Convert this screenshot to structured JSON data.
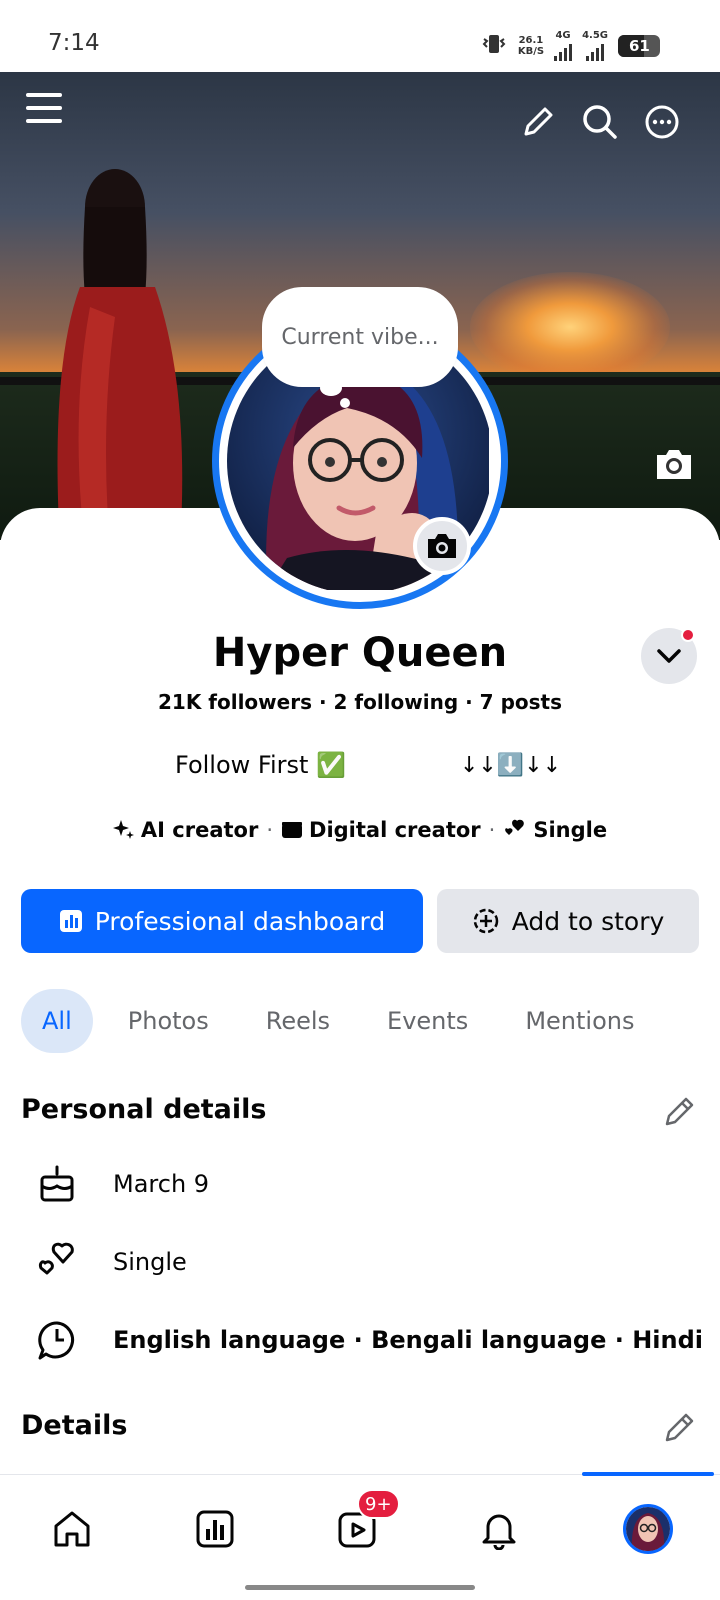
{
  "status_bar": {
    "time": "7:14",
    "net_speed_value": "26.1",
    "net_speed_unit": "KB/S",
    "sim1": "4G",
    "sim2": "4.5G",
    "battery": "61"
  },
  "header": {
    "menu_icon": "hamburger-icon",
    "edit_icon": "pencil-icon",
    "search_icon": "search-icon",
    "more_icon": "more-icon",
    "cover_camera_icon": "camera-icon"
  },
  "profile": {
    "note_placeholder": "Current vibe...",
    "name": "Hyper Queen",
    "stats": "21K followers · 2 following · 7 posts",
    "bio_line1": "Follow First ✅",
    "bio_line2": "↓↓⬇️↓↓",
    "categories": [
      {
        "label": "AI creator"
      },
      {
        "label": "Digital creator"
      },
      {
        "label": "Single"
      }
    ]
  },
  "actions": {
    "primary": "Professional dashboard",
    "secondary": "Add to story"
  },
  "tabs": [
    {
      "label": "All"
    },
    {
      "label": "Photos"
    },
    {
      "label": "Reels"
    },
    {
      "label": "Events"
    },
    {
      "label": "Mentions"
    }
  ],
  "personal_details": {
    "title": "Personal details",
    "rows": [
      {
        "icon": "cake-icon",
        "text": "March 9"
      },
      {
        "icon": "hearts-icon",
        "text": "Single"
      },
      {
        "icon": "language-icon",
        "text": "English language · Bengali language · Hindi"
      }
    ]
  },
  "details": {
    "title": "Details"
  },
  "bottom_nav": {
    "items": [
      {
        "icon": "home-icon"
      },
      {
        "icon": "dashboard-icon"
      },
      {
        "icon": "video-icon",
        "badge": "9+"
      },
      {
        "icon": "bell-icon"
      },
      {
        "icon": "profile-avatar"
      }
    ]
  },
  "colors": {
    "accent": "#0866ff",
    "notification": "#e41e3f",
    "secondary_button": "#e4e6eb"
  }
}
